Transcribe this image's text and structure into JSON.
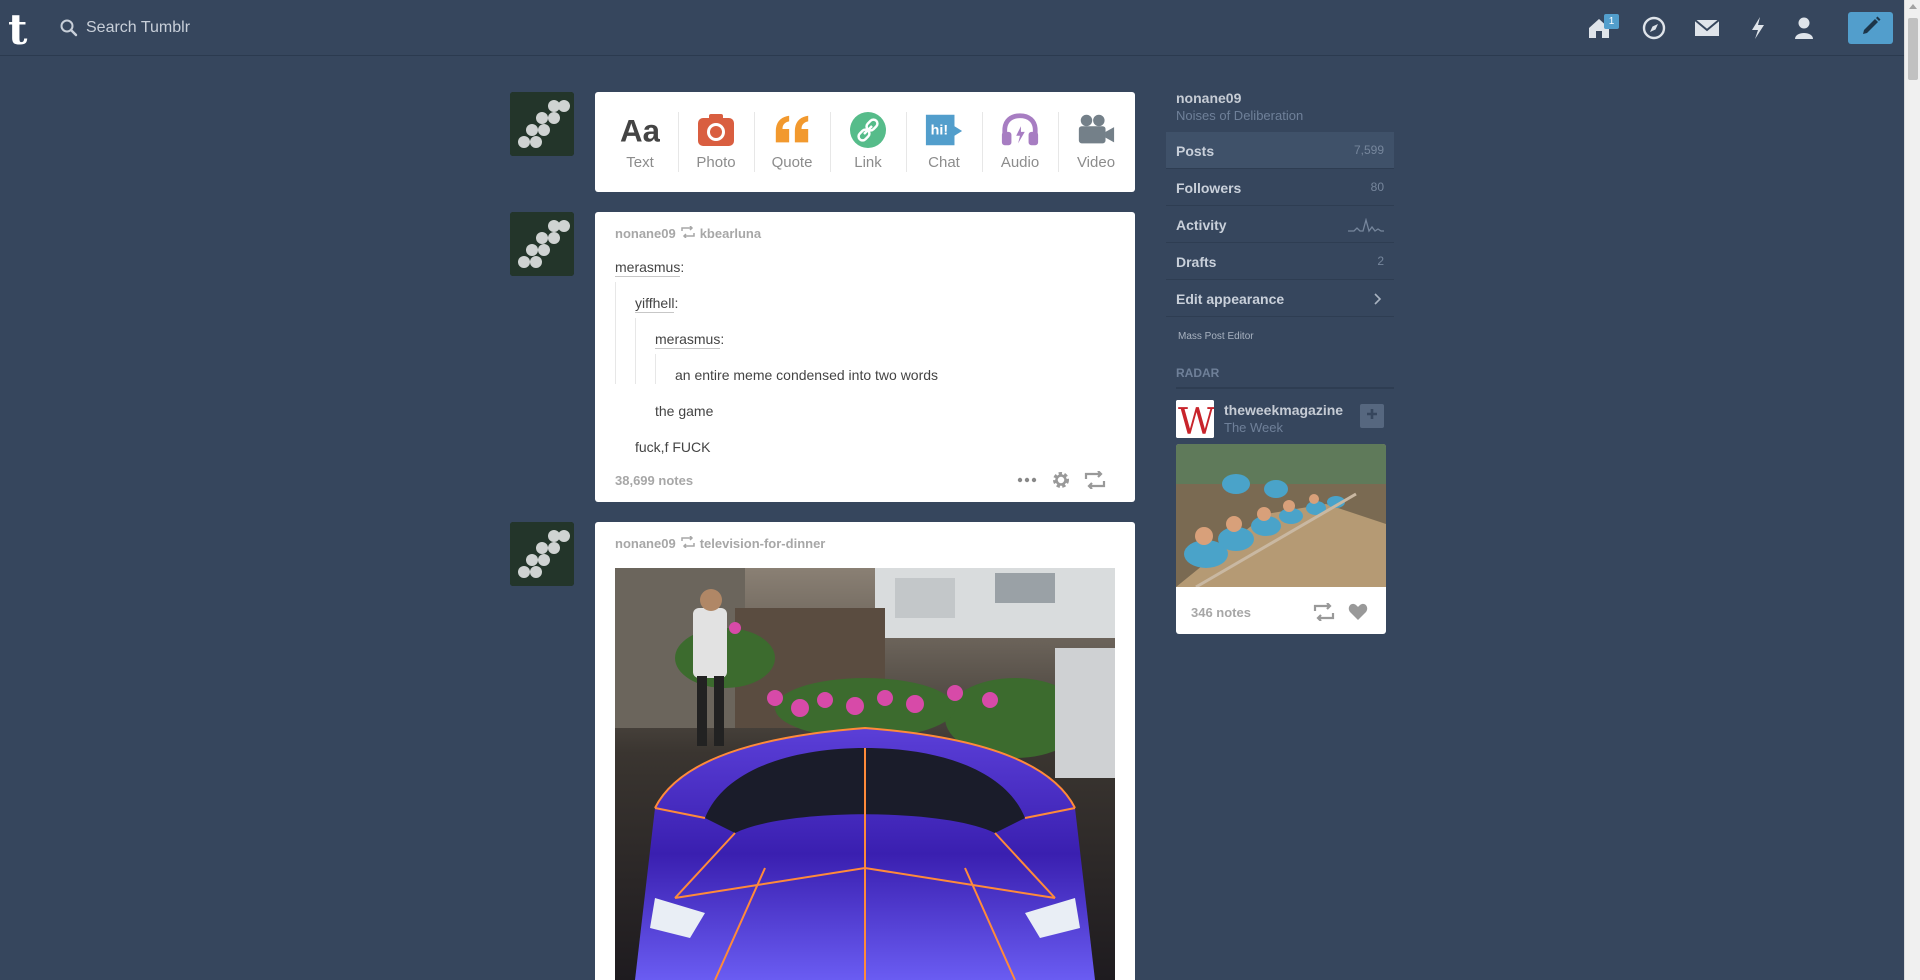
{
  "app": {
    "logo": "t",
    "search": {
      "placeholder": "Search Tumblr",
      "value": ""
    },
    "nav": {
      "home_icon": "home-icon",
      "home_badge": "1",
      "explore_icon": "compass-icon",
      "inbox_icon": "envelope-icon",
      "activity_icon": "lightning-icon",
      "account_icon": "user-icon",
      "compose_icon": "pencil-icon"
    },
    "colors": {
      "background": "#36465d",
      "accent": "#529ecc"
    }
  },
  "post_types": [
    {
      "label": "Text",
      "icon": "text-icon",
      "color": "#444444"
    },
    {
      "label": "Photo",
      "icon": "camera-icon",
      "color": "#d95e40"
    },
    {
      "label": "Quote",
      "icon": "quote-icon",
      "color": "#f2992e"
    },
    {
      "label": "Link",
      "icon": "link-icon",
      "color": "#56bc8a"
    },
    {
      "label": "Chat",
      "icon": "chat-icon",
      "color": "#529ecc"
    },
    {
      "label": "Audio",
      "icon": "headphones-icon",
      "color": "#a77dc2"
    },
    {
      "label": "Video",
      "icon": "video-camera-icon",
      "color": "#748089"
    }
  ],
  "posts": [
    {
      "author": "nonane09",
      "reblogged_from": "kbearluna",
      "thread": {
        "user1": "merasmus",
        "user2": "yiffhell",
        "user3": "merasmus",
        "quote_text": "an entire meme condensed into two words",
        "reply2": "the game",
        "reply1": "fuck,f FUCK"
      },
      "notes": "38,699 notes"
    },
    {
      "author": "nonane09",
      "reblogged_from": "television-for-dinner",
      "photo": "purple-lamborghini-photo"
    }
  ],
  "sidebar": {
    "blog_name": "nonane09",
    "blog_title": "Noises of Deliberation",
    "items": [
      {
        "label": "Posts",
        "count": "7,599"
      },
      {
        "label": "Followers",
        "count": "80"
      },
      {
        "label": "Activity",
        "count": ""
      },
      {
        "label": "Drafts",
        "count": "2"
      },
      {
        "label": "Edit appearance",
        "count": ""
      }
    ],
    "mass_post_editor": "Mass Post Editor",
    "radar": {
      "title": "RADAR",
      "blog_name": "theweekmagazine",
      "blog_title": "The Week",
      "logo_letter": "W",
      "notes": "346 notes"
    }
  }
}
